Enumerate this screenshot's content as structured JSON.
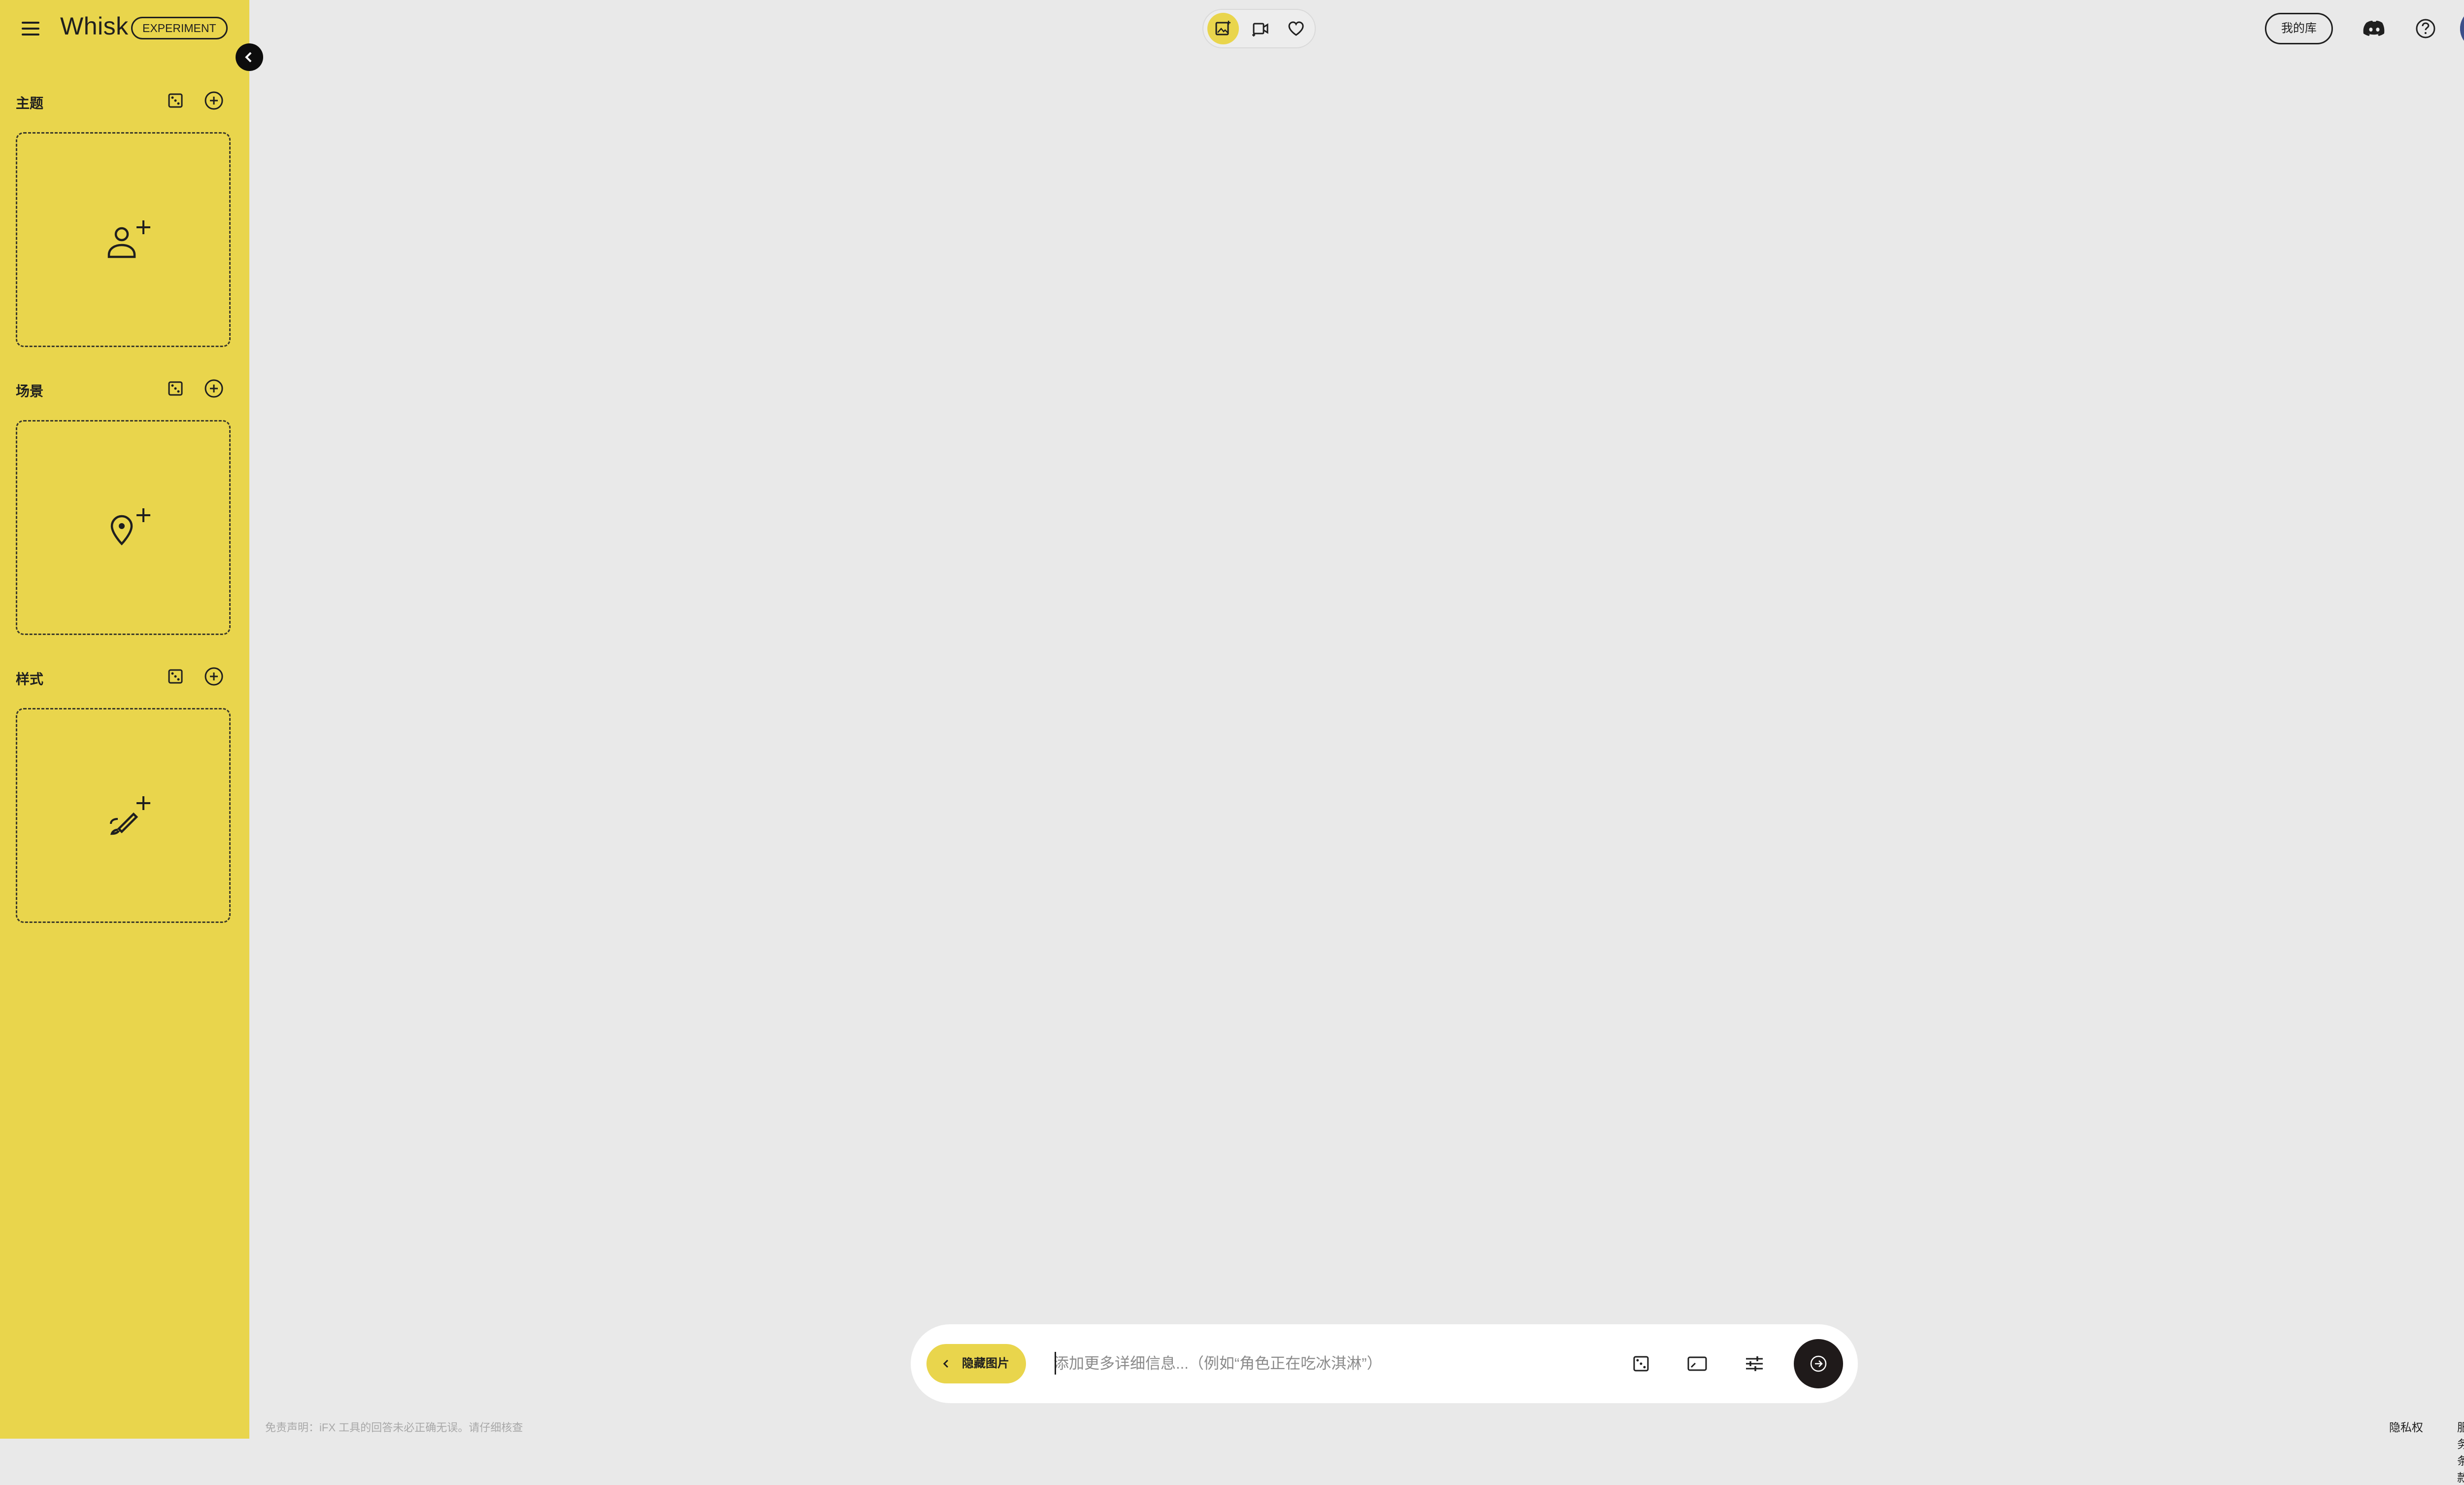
{
  "header": {
    "app_name": "Whisk",
    "badge": "EXPERIMENT",
    "library_button": "我的库"
  },
  "sidebar": {
    "sections": [
      {
        "title": "主题"
      },
      {
        "title": "场景"
      },
      {
        "title": "样式"
      }
    ]
  },
  "prompt": {
    "hide_images_label": "隐藏图片",
    "placeholder": "添加更多详细信息...（例如“角色正在吃冰淇淋”）",
    "value": ""
  },
  "footer": {
    "disclaimer": "免责声明：iFX 工具的回答未必正确无误。请仔细核查",
    "privacy": "隐私权",
    "terms": "服务条款"
  },
  "colors": {
    "accent": "#e9d54c",
    "background": "#e9e9e9",
    "dark": "#1f1f1f",
    "extension": "#6b4cf6"
  },
  "icons": [
    "menu-icon",
    "chevron-left-icon",
    "dice-icon",
    "add-circle-icon",
    "person-add-icon",
    "location-add-icon",
    "brush-add-icon",
    "image-create-icon",
    "video-create-icon",
    "heart-icon",
    "discord-icon",
    "help-icon",
    "aspect-ratio-icon",
    "tune-icon",
    "arrow-right-icon"
  ]
}
